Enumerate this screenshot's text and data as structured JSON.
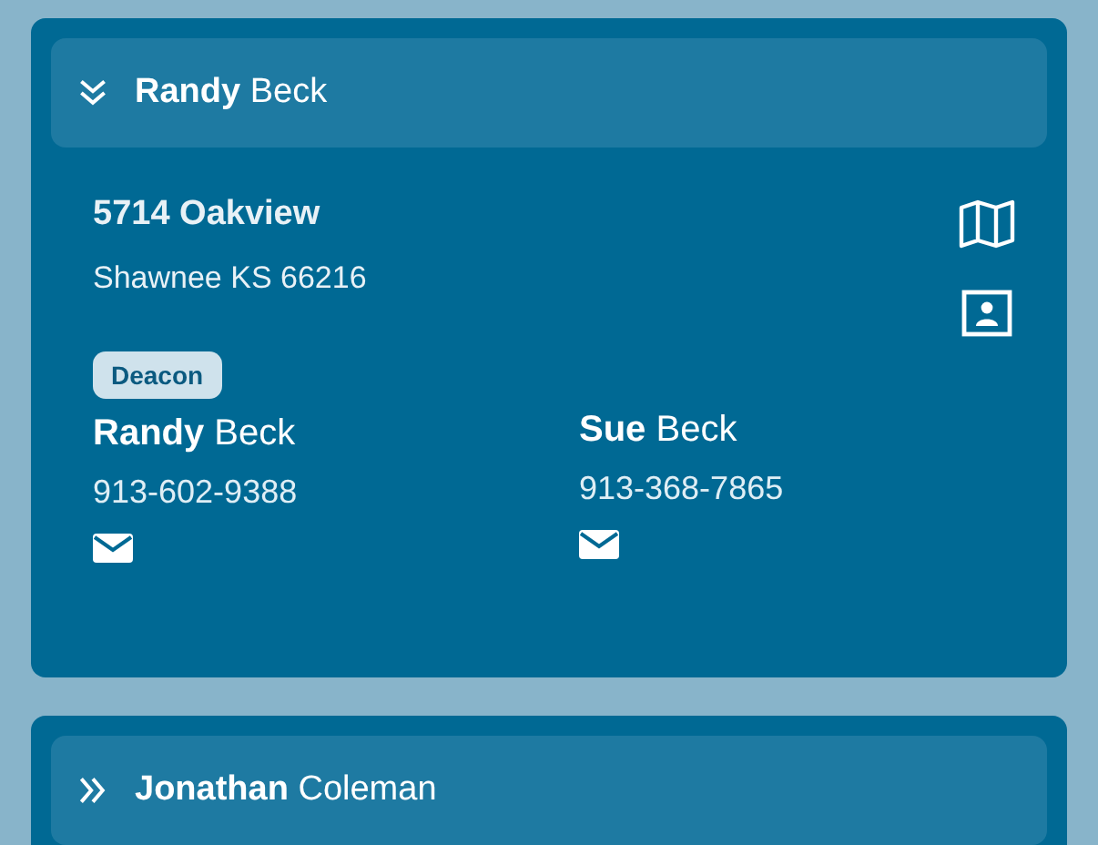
{
  "families": [
    {
      "first": "Randy",
      "last": "Beck",
      "expanded": true,
      "address": [
        "5714 Oakview",
        "Shawnee KS 66216"
      ],
      "members": [
        {
          "role": "Deacon",
          "first": "Randy",
          "last": "Beck",
          "phone": "913-602-9388"
        },
        {
          "first": "Sue",
          "last": "Beck",
          "phone": "913-368-7865"
        }
      ]
    },
    {
      "first": "Jonathan",
      "last": "Coleman",
      "expanded": false
    }
  ]
}
